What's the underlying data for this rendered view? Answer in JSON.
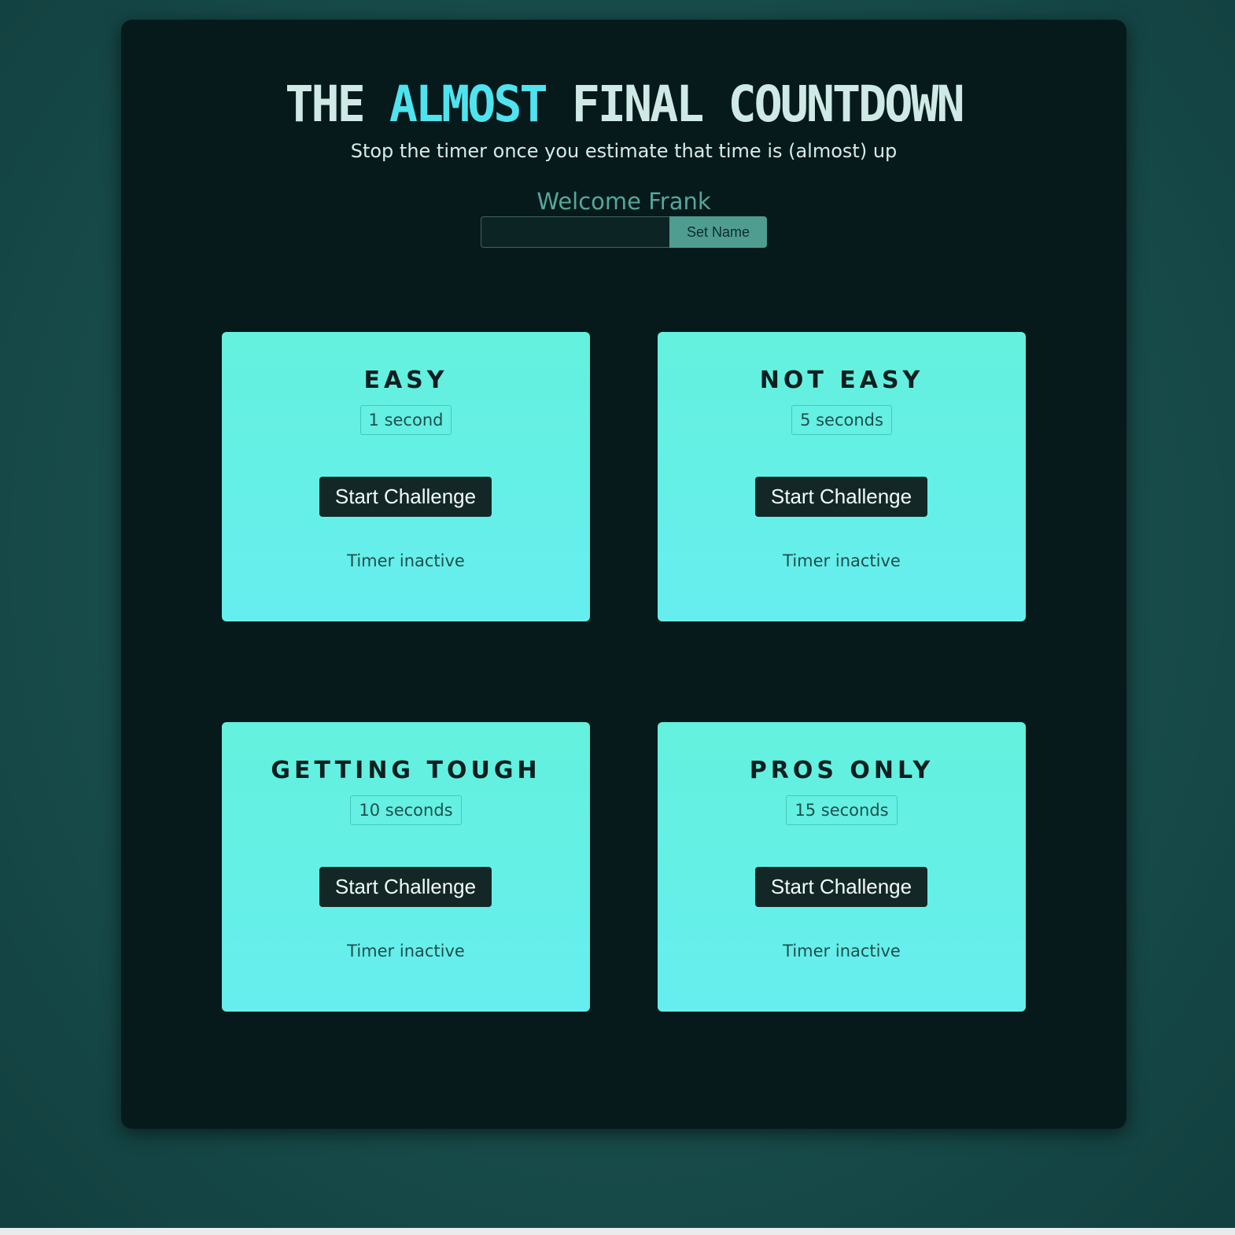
{
  "header": {
    "title_prefix": "THE",
    "title_accent": "ALMOST",
    "title_suffix": "FINAL COUNTDOWN",
    "subtitle": "Stop the timer once you estimate that time is (almost) up",
    "welcome": "Welcome Frank"
  },
  "name_form": {
    "input_value": "",
    "input_placeholder": "",
    "button_label": "Set Name"
  },
  "challenges": [
    {
      "title": "EASY",
      "duration": "1 second",
      "button_label": "Start Challenge",
      "status": "Timer inactive"
    },
    {
      "title": "NOT EASY",
      "duration": "5 seconds",
      "button_label": "Start Challenge",
      "status": "Timer inactive"
    },
    {
      "title": "GETTING TOUGH",
      "duration": "10 seconds",
      "button_label": "Start Challenge",
      "status": "Timer inactive"
    },
    {
      "title": "PROS ONLY",
      "duration": "15 seconds",
      "button_label": "Start Challenge",
      "status": "Timer inactive"
    }
  ],
  "colors": {
    "background": "#1a504e",
    "panel": "#061a1b",
    "accent": "#4fe3ef",
    "card_top": "#64f1dd",
    "card_bottom": "#66eeef",
    "button_dark": "#132826",
    "set_name_button": "#4f9d91",
    "welcome_text": "#55a79b"
  }
}
